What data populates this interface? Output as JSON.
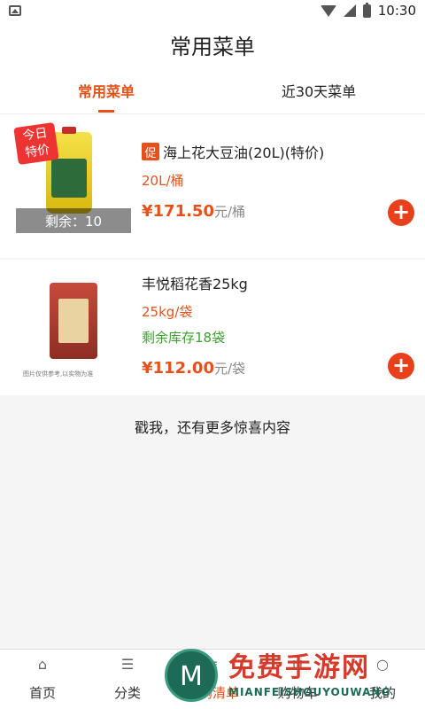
{
  "status_bar": {
    "time": "10:30"
  },
  "header": {
    "title": "常用菜单"
  },
  "tabs": [
    {
      "label": "常用菜单",
      "active": true
    },
    {
      "label": "近30天菜单",
      "active": false
    }
  ],
  "products": [
    {
      "promo_tag": "促",
      "title": "海上花大豆油(20L)(特价)",
      "unit": "20L/桶",
      "price": "¥171.50",
      "price_unit": "元/桶",
      "badge": "今日\n特价",
      "stock_overlay": "剩余：10"
    },
    {
      "title": "丰悦稻花香25kg",
      "unit": "25kg/袋",
      "stock_text": "剩余库存18袋",
      "price": "¥112.00",
      "price_unit": "元/袋",
      "thumb_note": "图片仅供参考,以实物为准"
    }
  ],
  "more_text": "戳我，还有更多惊喜内容",
  "bottom_nav": [
    {
      "label": "首页",
      "icon": "home-icon"
    },
    {
      "label": "分类",
      "icon": "category-icon"
    },
    {
      "label": "常购清单",
      "icon": "list-icon",
      "active": true
    },
    {
      "label": "购物车",
      "icon": "cart-icon"
    },
    {
      "label": "我的",
      "icon": "user-icon"
    }
  ],
  "watermark": {
    "text": "免费手游网",
    "sub": "MIANFEISHOUYOUWANG"
  },
  "colors": {
    "accent": "#e8501a",
    "stock_green": "#3aa02e"
  }
}
